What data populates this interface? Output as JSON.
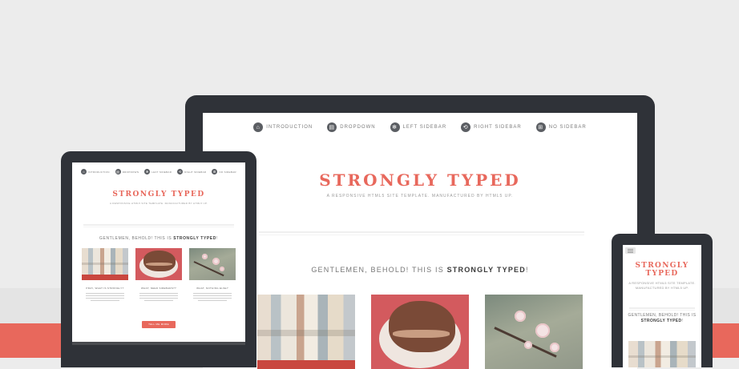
{
  "site": {
    "brand": "STRONGLY TYPED",
    "tagline": "A RESPONSIVE HTML5 SITE TEMPLATE. MANUFACTURED BY HTML5 UP.",
    "headline_prefix": "GENTLEMEN, BEHOLD! THIS IS ",
    "headline_emphasis": "STRONGLY TYPED",
    "headline_suffix": "!"
  },
  "nav": [
    {
      "label": "INTRODUCTION",
      "icon": "home-icon",
      "glyph": "⌂"
    },
    {
      "label": "DROPDOWN",
      "icon": "chart-icon",
      "glyph": "▤"
    },
    {
      "label": "LEFT SIDEBAR",
      "icon": "cog-icon",
      "glyph": "✻"
    },
    {
      "label": "RIGHT SIDEBAR",
      "icon": "retweet-icon",
      "glyph": "⟲"
    },
    {
      "label": "NO SIDEBAR",
      "icon": "sitemap-icon",
      "glyph": "⊞"
    }
  ],
  "tablet": {
    "col_titles": [
      "PRAY, WHAT IS STRONGLY?",
      "WHAT, NEED SIDEBARS??",
      "WHAT, NOTHING ELSE?"
    ],
    "cta": "TELL ME MORE"
  },
  "colors": {
    "accent": "#e8685c",
    "device": "#2f3238",
    "background": "#ececec"
  }
}
